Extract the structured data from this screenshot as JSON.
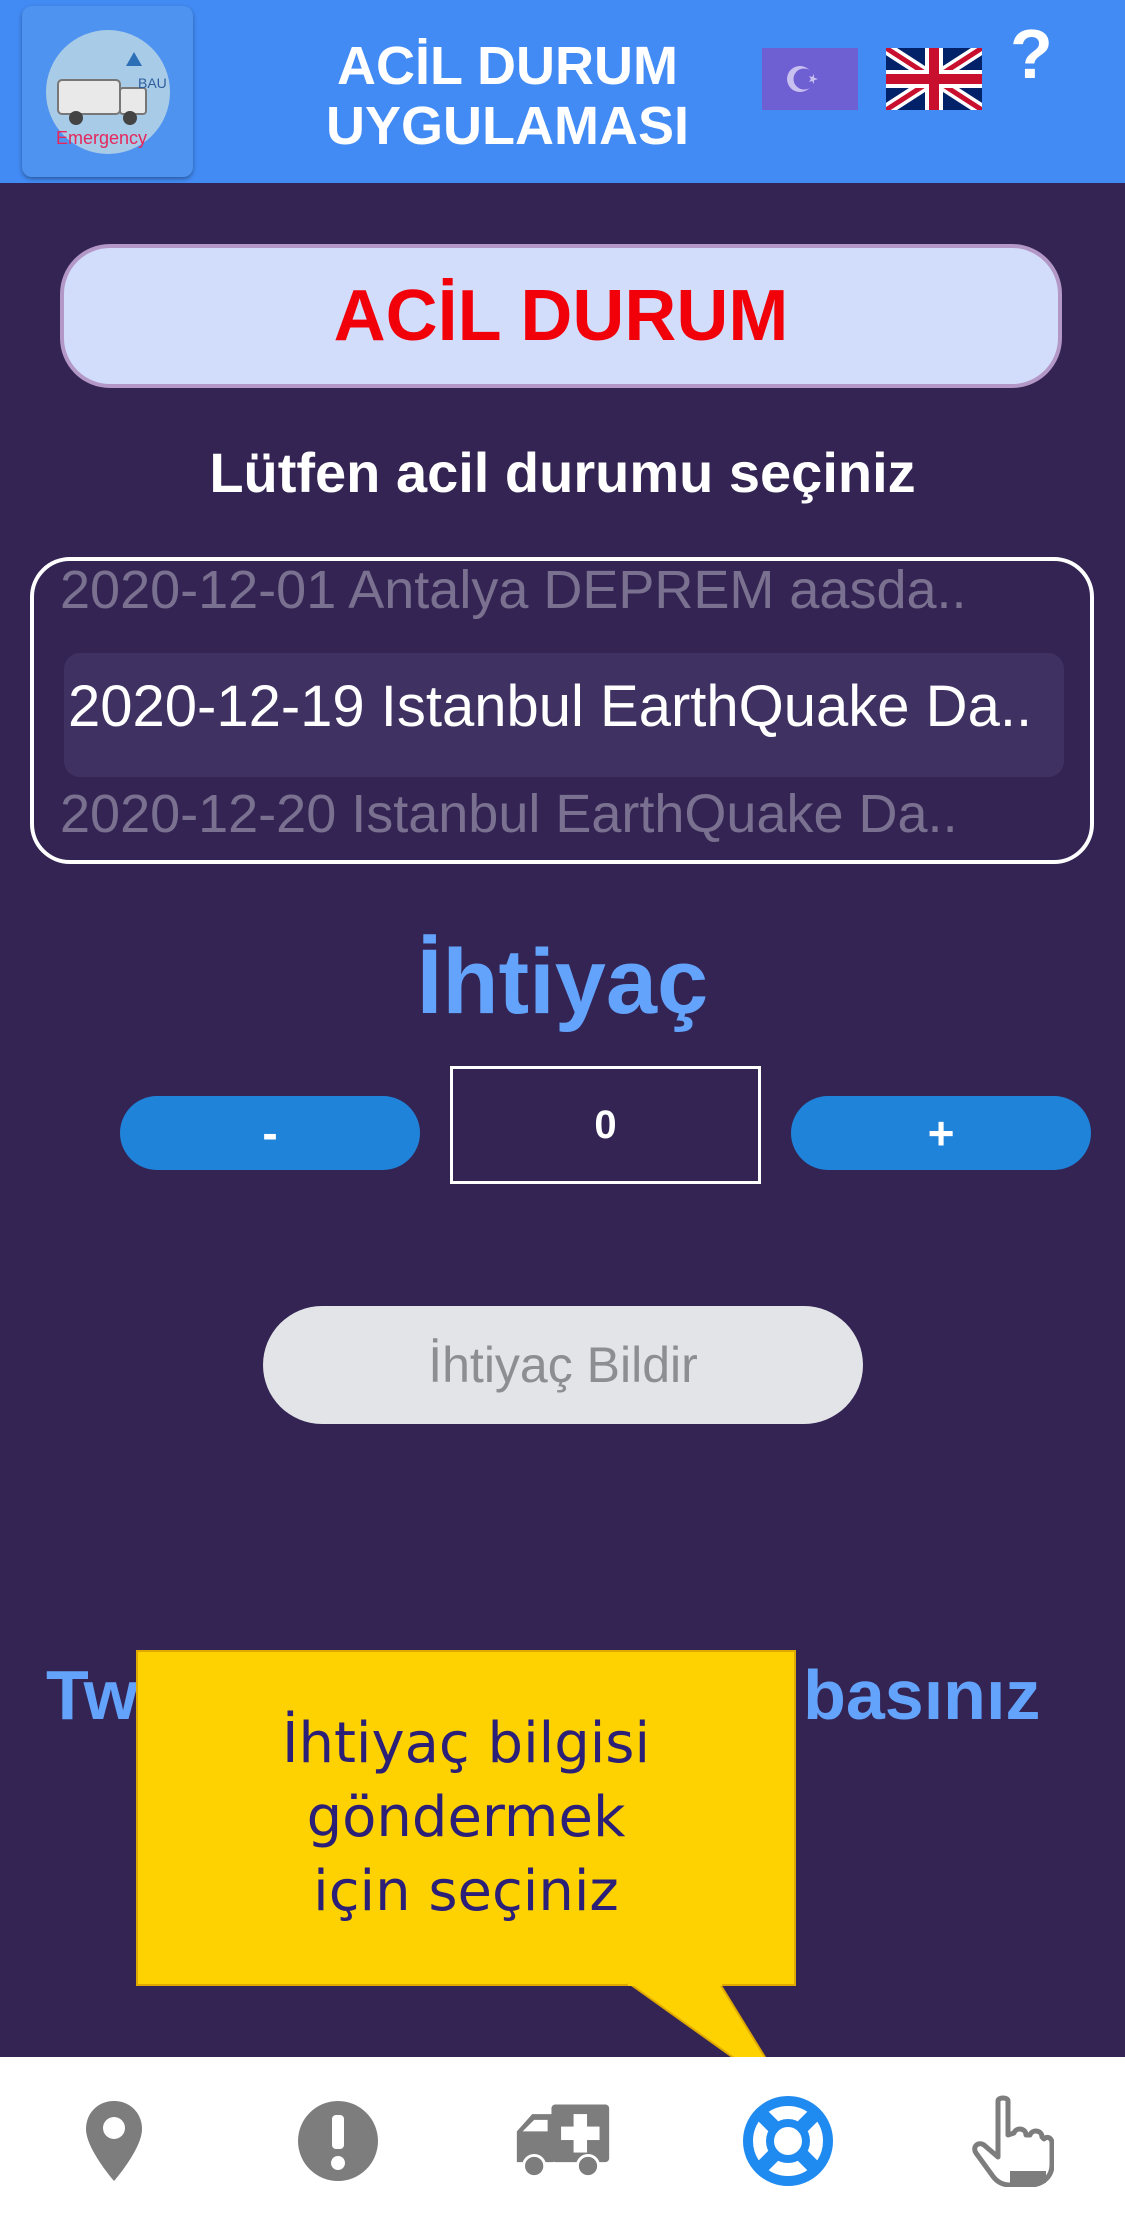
{
  "header": {
    "title_line1": "ACİL DURUM",
    "title_line2": "UYGULAMASI",
    "logo_text": "BAU",
    "logo_caption": "Emergency",
    "help": "?",
    "flags": [
      "turkey-flag-icon",
      "uk-flag-icon"
    ]
  },
  "emergency_button": "ACİL DURUM",
  "select_prompt": "Lütfen acil durumu seçiniz",
  "picker": {
    "items": [
      "2020-12-01 Antalya DEPREM aasda..",
      "2020-12-19 Istanbul EarthQuake Da..",
      "2020-12-20 Istanbul EarthQuake Da.."
    ]
  },
  "need": {
    "title": "İhtiyaç",
    "minus": "-",
    "plus": "+",
    "quantity": "0",
    "report_button": "İhtiyaç Bildir"
  },
  "partial_text": "Tw                               n basınız",
  "tooltip": {
    "line1": "İhtiyaç bilgisi",
    "line2": "göndermek",
    "line3": "için seçiniz"
  },
  "tabs": [
    "map-pin-icon",
    "alert-icon",
    "ambulance-icon",
    "lifebuoy-icon",
    "hand-pointer-icon"
  ],
  "colors": {
    "background": "#332453",
    "header": "#428bf4",
    "accent_blue": "#63a3fb",
    "emergency_red": "#f2000a",
    "tooltip_yellow": "#fed200",
    "active_tab": "#1f8af0"
  }
}
